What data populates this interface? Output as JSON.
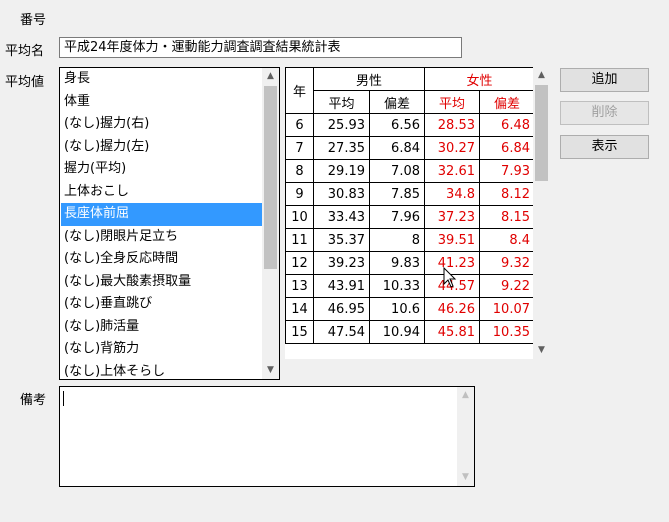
{
  "labels": {
    "number": "番号",
    "avg_name": "平均名",
    "avg_value": "平均値",
    "remarks": "備考"
  },
  "avg_name_value": "平成24年度体力・運動能力調査調査結果統計表",
  "list": {
    "selected_index": 6,
    "items": [
      "身長",
      "体重",
      "(なし)握力(右)",
      "(なし)握力(左)",
      "握力(平均)",
      "上体おこし",
      "長座体前屈",
      "(なし)閉眼片足立ち",
      "(なし)全身反応時間",
      "(なし)最大酸素摂取量",
      "(なし)垂直跳び",
      "(なし)肺活量",
      "(なし)背筋力",
      "(なし)上体そらし"
    ]
  },
  "grid": {
    "year_header": "年",
    "male_header": "男性",
    "female_header": "女性",
    "sub_headers": [
      "平均",
      "偏差",
      "平均",
      "偏差"
    ],
    "rows": [
      [
        "6",
        "25.93",
        "6.56",
        "28.53",
        "6.48"
      ],
      [
        "7",
        "27.35",
        "6.84",
        "30.27",
        "6.84"
      ],
      [
        "8",
        "29.19",
        "7.08",
        "32.61",
        "7.93"
      ],
      [
        "9",
        "30.83",
        "7.85",
        "34.8",
        "8.12"
      ],
      [
        "10",
        "33.43",
        "7.96",
        "37.23",
        "8.15"
      ],
      [
        "11",
        "35.37",
        "8",
        "39.51",
        "8.4"
      ],
      [
        "12",
        "39.23",
        "9.83",
        "41.23",
        "9.32"
      ],
      [
        "13",
        "43.91",
        "10.33",
        "44.57",
        "9.22"
      ],
      [
        "14",
        "46.95",
        "10.6",
        "46.26",
        "10.07"
      ],
      [
        "15",
        "47.54",
        "10.94",
        "45.81",
        "10.35"
      ]
    ]
  },
  "buttons": {
    "add": "追加",
    "delete": "削除",
    "show": "表示"
  },
  "remarks_value": "",
  "colors": {
    "female": "#e00000",
    "selection": "#3399ff"
  },
  "icons": {
    "scroll_up": "up-arrow",
    "scroll_down": "down-arrow",
    "mouse_cursor": "arrow-pointer"
  }
}
